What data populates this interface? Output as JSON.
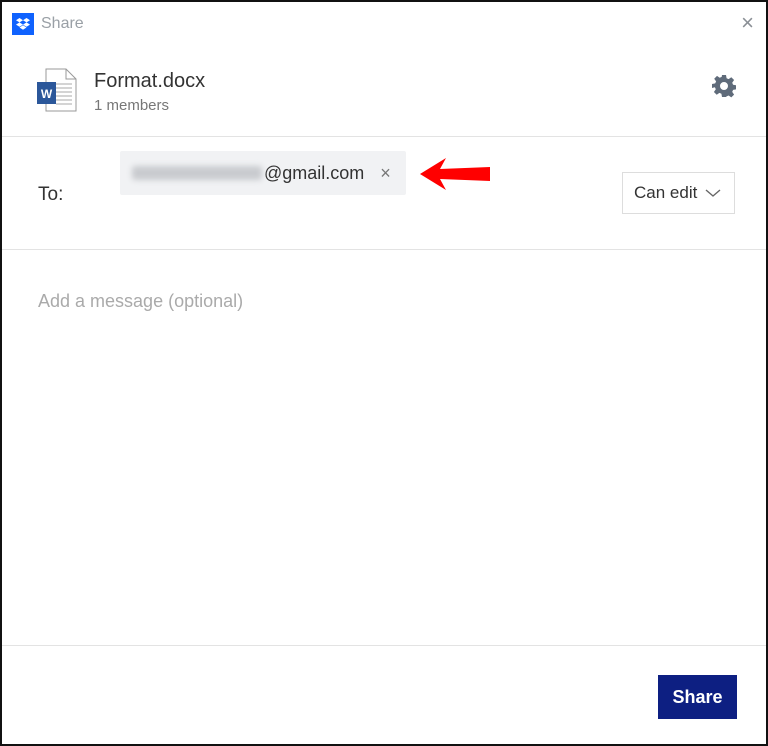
{
  "window": {
    "title": "Share",
    "close_label": "×"
  },
  "file": {
    "name": "Format.docx",
    "members": "1 members",
    "icon": "word-doc-icon"
  },
  "recipients": {
    "label": "To:",
    "chips": [
      {
        "email_domain": "@gmail.com",
        "remove_label": "×"
      }
    ]
  },
  "permission": {
    "selected": "Can edit"
  },
  "message": {
    "placeholder": "Add a message (optional)"
  },
  "footer": {
    "share_label": "Share"
  },
  "colors": {
    "accent": "#0d1f82",
    "dropbox_blue": "#0f62fe",
    "annotation_arrow": "#ff0000"
  }
}
